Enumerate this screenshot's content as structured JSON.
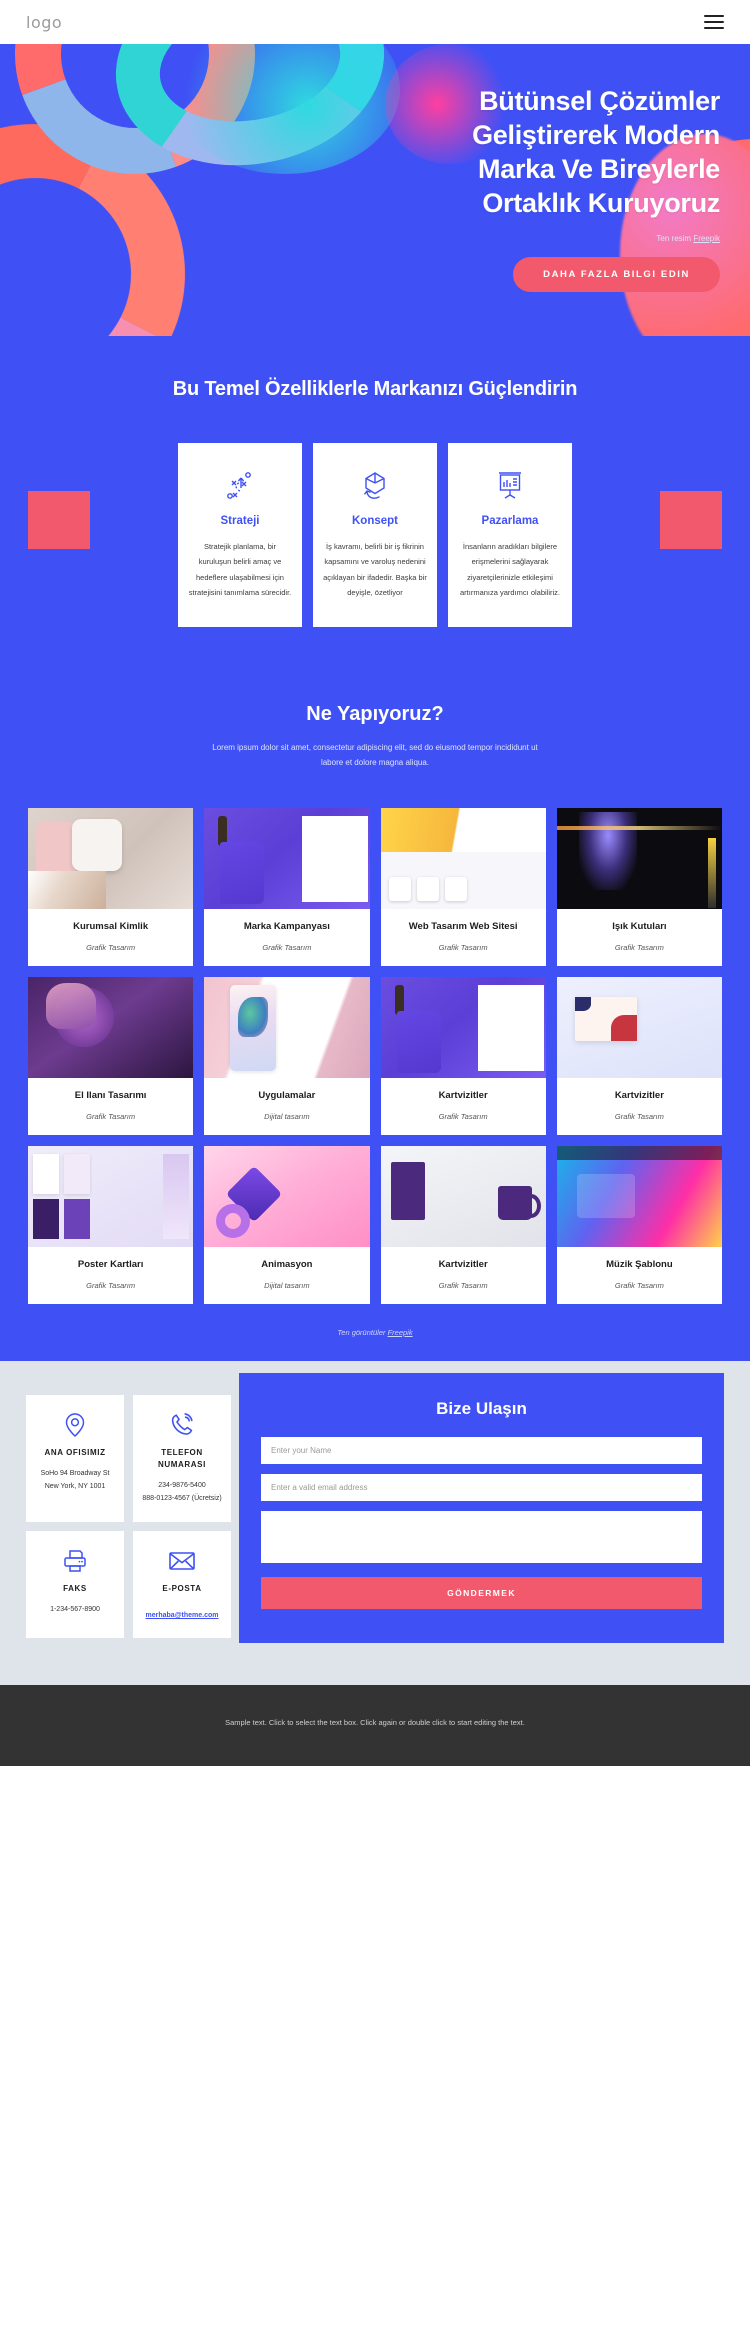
{
  "header": {
    "logo": "logo",
    "menu_icon": "hamburger-menu-icon"
  },
  "hero": {
    "title_lines": [
      "Bütünsel Çözümler",
      "Geliştirerek Modern",
      "Marka Ve Bireylerle",
      "Ortaklık Kuruyoruz"
    ],
    "credit_prefix": "Ten resim ",
    "credit_link": "Freepik",
    "cta_label": "DAHA FAZLA BILGI EDIN"
  },
  "features": {
    "heading": "Bu Temel Özelliklerle Markanızı Güçlendirin",
    "cards": [
      {
        "icon": "strategy-icon",
        "title": "Strateji",
        "text": "Stratejik planlama, bir kuruluşun belirli amaç ve hedeflere ulaşabilmesi için stratejisini tanımlama sürecidir."
      },
      {
        "icon": "concept-cube-icon",
        "title": "Konsept",
        "text": "İş kavramı, belirli bir iş fikrinin kapsamını ve varoluş nedenini açıklayan bir ifadedir. Başka bir deyişle, özetliyor"
      },
      {
        "icon": "presentation-chart-icon",
        "title": "Pazarlama",
        "text": "İnsanların aradıkları bilgilere erişmelerini sağlayarak ziyaretçilerinizle etkileşimi artırmanıza yardımcı olabiliriz."
      }
    ]
  },
  "work": {
    "heading": "Ne Yapıyoruz?",
    "subtitle": "Lorem ipsum dolor sit amet, consectetur adipiscing elit, sed do eiusmod tempor incididunt ut labore et dolore magna aliqua.",
    "items": [
      {
        "title": "Kurumsal Kimlik",
        "category": "Grafik Tasarım",
        "thumb": "t-brand"
      },
      {
        "title": "Marka Kampanyası",
        "category": "Grafik Tasarım",
        "thumb": "t-purple"
      },
      {
        "title": "Web Tasarım Web Sitesi",
        "category": "Grafik Tasarım",
        "thumb": "t-white"
      },
      {
        "title": "Işık Kutuları",
        "category": "Grafik Tasarım",
        "thumb": "t-dark"
      },
      {
        "title": "El Ilanı Tasarımı",
        "category": "Grafik Tasarım",
        "thumb": "t-poster"
      },
      {
        "title": "Uygulamalar",
        "category": "Dijital tasarım",
        "thumb": "t-phone"
      },
      {
        "title": "Kartvizitler",
        "category": "Grafik Tasarım",
        "thumb": "t-purple"
      },
      {
        "title": "Kartvizitler",
        "category": "Grafik Tasarım",
        "thumb": "t-card"
      },
      {
        "title": "Poster Kartları",
        "category": "Grafik Tasarım",
        "thumb": "t-brochure"
      },
      {
        "title": "Animasyon",
        "category": "Dijital tasarım",
        "thumb": "t-3d"
      },
      {
        "title": "Kartvizitler",
        "category": "Grafik Tasarım",
        "thumb": "t-mug"
      },
      {
        "title": "Müzik Şablonu",
        "category": "Grafik Tasarım",
        "thumb": "t-music"
      }
    ],
    "grid_credit_prefix": "Ten görüntüler ",
    "grid_credit_link": "Freepik"
  },
  "contact": {
    "cards": [
      {
        "icon": "location-pin-icon",
        "title": "ANA OFISIMIZ",
        "line1": "SoHo 94 Broadway St",
        "line2": "New York, NY 1001",
        "is_mail": false
      },
      {
        "icon": "phone-icon",
        "title": "TELEFON NUMARASI",
        "line1": "234-9876-5400",
        "line2": "888-0123-4567 (Ücretsiz)",
        "is_mail": false
      },
      {
        "icon": "fax-printer-icon",
        "title": "FAKS",
        "line1": "1-234-567-8900",
        "line2": "",
        "is_mail": false
      },
      {
        "icon": "envelope-icon",
        "title": "E-POSTA",
        "line1": "merhaba@theme.com",
        "line2": "",
        "is_mail": true
      }
    ],
    "form": {
      "heading": "Bize Ulaşın",
      "name_placeholder": "Enter your Name",
      "email_placeholder": "Enter a valid email address",
      "message_placeholder": "",
      "submit_label": "GÖNDERMEK"
    }
  },
  "footer": {
    "text": "Sample text. Click to select the text box. Click again or double click to start editing the text."
  },
  "colors": {
    "brand_blue": "#3f51f5",
    "accent_pink": "#f2596d",
    "contact_bg": "#dfe3ea",
    "footer_bg": "#333333"
  }
}
